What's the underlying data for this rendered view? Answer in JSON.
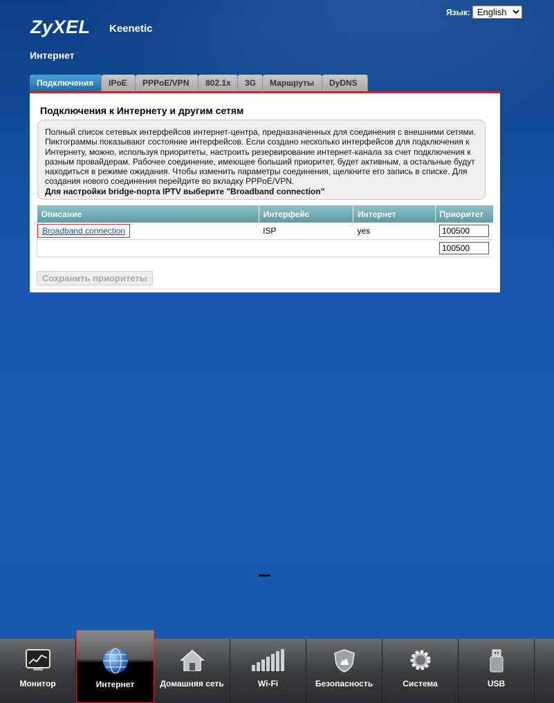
{
  "header": {
    "logo": "ZyXEL",
    "product": "Keenetic",
    "language_label": "Язык:",
    "language_value": "English"
  },
  "section_title": "Интернет",
  "tabs": [
    {
      "label": "Подключения",
      "active": true
    },
    {
      "label": "IPoE"
    },
    {
      "label": "PPPoE/VPN"
    },
    {
      "label": "802.1x"
    },
    {
      "label": "3G"
    },
    {
      "label": "Маршруты"
    },
    {
      "label": "DyDNS"
    }
  ],
  "panel": {
    "title": "Подключения к Интернету и другим сетям",
    "info_text": "Полный список сетевых интерфейсов интернет-центра, предназначенных для соединения с внешними сетями. Пиктограммы показывают состояние интерфейсов. Если создано несколько интерфейсов для подключения к Интернету, можно, используя приоритеты, настроить резервирование интернет-канала за счет подключения к разным провайдерам. Рабочее соединение, имеющее больший приоритет, будет активным, а остальные будут находиться в режиме ожидания. Чтобы изменить параметры соединения, щелкните его запись в списке. Для создания нового соединения перейдите во вкладку PPPoE/VPN.",
    "info_bold": "Для настройки bridge-порта IPTV выберите \"Broadband connection\"",
    "table": {
      "headers": [
        "Описание",
        "Интерфейс",
        "Интернет",
        "Приоритет"
      ],
      "rows": [
        {
          "description": "Broadband connection",
          "interface": "ISP",
          "internet": "yes",
          "priority": "100500"
        },
        {
          "description": "",
          "interface": "",
          "internet": "",
          "priority": "100500"
        }
      ]
    },
    "save_label": "Сохранить приоритеты"
  },
  "dock": [
    {
      "label": "Монитор",
      "icon": "monitor-icon"
    },
    {
      "label": "Интернет",
      "icon": "globe-icon",
      "active": true
    },
    {
      "label": "Домашняя сеть",
      "icon": "home-icon"
    },
    {
      "label": "Wi-Fi",
      "icon": "wifi-bars-icon"
    },
    {
      "label": "Безопасность",
      "icon": "shield-icon"
    },
    {
      "label": "Система",
      "icon": "gear-icon"
    },
    {
      "label": "USB",
      "icon": "usb-icon"
    }
  ],
  "colors": {
    "accent_red": "#c1272d",
    "active_tab": "#1f6fa8",
    "table_header": "#6fa8b0",
    "link": "#1a4f8c"
  }
}
